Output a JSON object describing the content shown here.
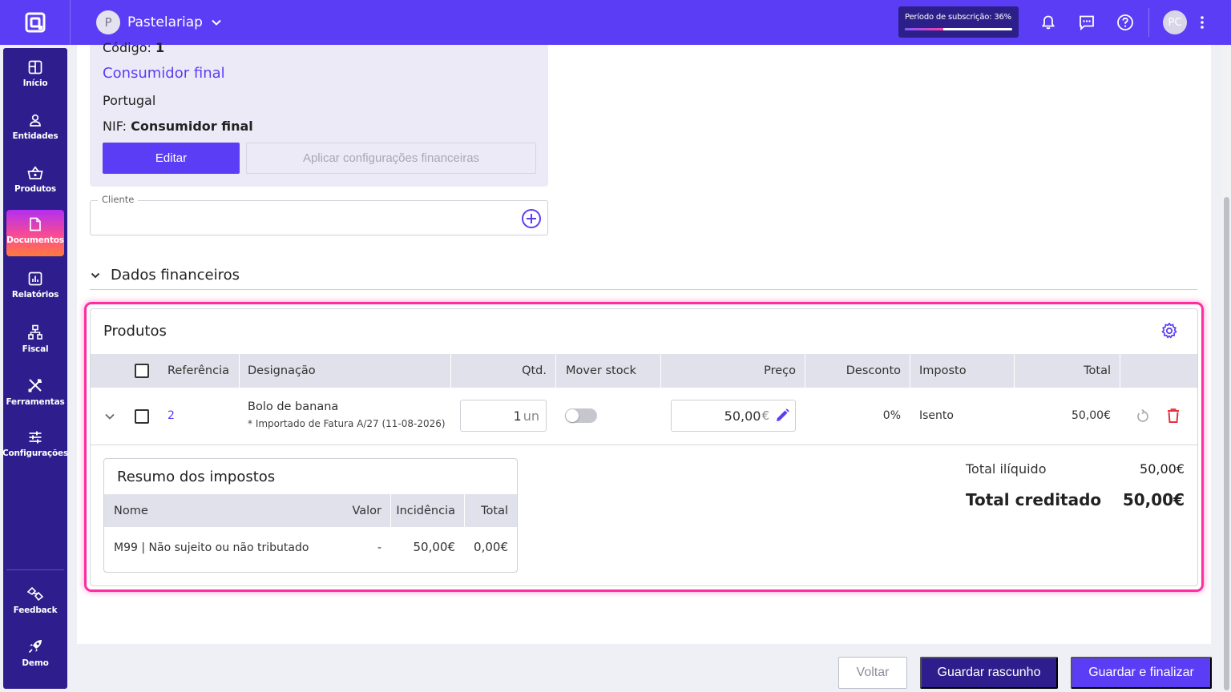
{
  "topbar": {
    "company_initial": "P",
    "company_name": "Pastelariap",
    "subscription_label": "Período de subscrição: 36%",
    "subscription_progress": 36,
    "user_initials": "PC"
  },
  "sidebar": {
    "items": [
      {
        "label": "Início",
        "icon": "grid-icon"
      },
      {
        "label": "Entidades",
        "icon": "person-icon"
      },
      {
        "label": "Produtos",
        "icon": "basket-icon"
      },
      {
        "label": "Documentos",
        "icon": "document-icon",
        "active": true
      },
      {
        "label": "Relatórios",
        "icon": "chart-icon"
      },
      {
        "label": "Fiscal",
        "icon": "hierarchy-icon"
      },
      {
        "label": "Ferramentas",
        "icon": "tools-icon"
      },
      {
        "label": "Configurações",
        "icon": "sliders-icon"
      }
    ],
    "bottom": [
      {
        "label": "Feedback",
        "icon": "feedback-icon"
      },
      {
        "label": "Demo",
        "icon": "rocket-icon"
      }
    ]
  },
  "entity": {
    "codigo_label": "Código:",
    "codigo_value": "1",
    "name": "Consumidor final",
    "country": "Portugal",
    "nif_label": "NIF:",
    "nif_value": "Consumidor final",
    "edit_label": "Editar",
    "apply_label": "Aplicar configurações financeiras"
  },
  "client_field": {
    "legend": "Cliente"
  },
  "financial_section": {
    "title": "Dados financeiros"
  },
  "products": {
    "title": "Produtos",
    "columns": {
      "referencia": "Referência",
      "designacao": "Designação",
      "qtd": "Qtd.",
      "mover_stock": "Mover stock",
      "preco": "Preço",
      "desconto": "Desconto",
      "imposto": "Imposto",
      "total": "Total"
    },
    "rows": [
      {
        "referencia": "2",
        "designacao": "Bolo de banana",
        "note": "* Importado de Fatura A/27 (11-08-2026)",
        "qtd": "1",
        "unit": "un",
        "mover_stock": false,
        "preco": "50,00",
        "currency": "€",
        "desconto": "0%",
        "imposto": "Isento",
        "total": "50,00€"
      }
    ]
  },
  "tax_summary": {
    "title": "Resumo dos impostos",
    "columns": {
      "nome": "Nome",
      "valor": "Valor",
      "incidencia": "Incidência",
      "total": "Total"
    },
    "rows": [
      {
        "nome": "M99 | Não sujeito ou não tributado",
        "valor": "-",
        "incidencia": "50,00€",
        "total": "0,00€"
      }
    ]
  },
  "totals": {
    "liquido_label": "Total ilíquido",
    "liquido_value": "50,00€",
    "creditado_label": "Total creditado",
    "creditado_value": "50,00€"
  },
  "footer": {
    "back_label": "Voltar",
    "draft_label": "Guardar rascunho",
    "final_label": "Guardar e finalizar"
  },
  "colors": {
    "primary": "#5b3df5",
    "sidebar": "#2e1d8c",
    "highlight": "#ff2d9f",
    "danger": "#e5323b"
  }
}
